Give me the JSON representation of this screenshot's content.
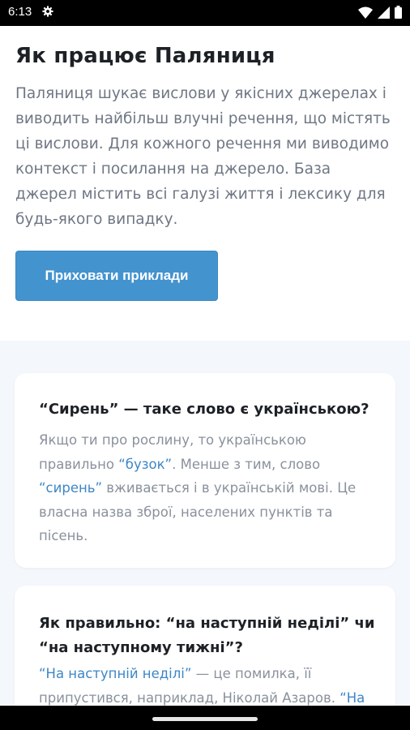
{
  "status": {
    "time": "6:13",
    "icons": [
      "gear-icon",
      "wifi-icon",
      "signal-icon",
      "battery-icon"
    ]
  },
  "header": {
    "title": "Як працює Паляниця",
    "intro": "Паляниця шукає вислови у якісних джерелах і виводить найбільш влучні речення, що містять ці вислови. Для кожного речення ми виводимо контекст і посилання на джерело. База джерел містить всі галузі життя і лексику для будь-якого випадку.",
    "hide_button": "Приховати приклади"
  },
  "cards": [
    {
      "title": "“Сирень” — таке слово є українською?",
      "body": {
        "p1": "Якщо ти про рослину, то українською правильно ",
        "link1": "“бузок”",
        "p2": ". Менше з тим, слово ",
        "link2": "“сирень”",
        "p3": " вживається і в українській мові. Це власна назва зброї, населених пунктів та пісень."
      }
    },
    {
      "title": "Як правильно: “на наступній неділі” чи “на наступному тижні”?",
      "body": {
        "link1": "“На наступній неділі”",
        "p1": " — це помилка, її припустився, наприклад, Ніколай Азаров. ",
        "link2": "“На"
      }
    }
  ],
  "colors": {
    "accent": "#4393cf",
    "link": "#3d86c6",
    "page_bg": "#f4f7fb"
  }
}
